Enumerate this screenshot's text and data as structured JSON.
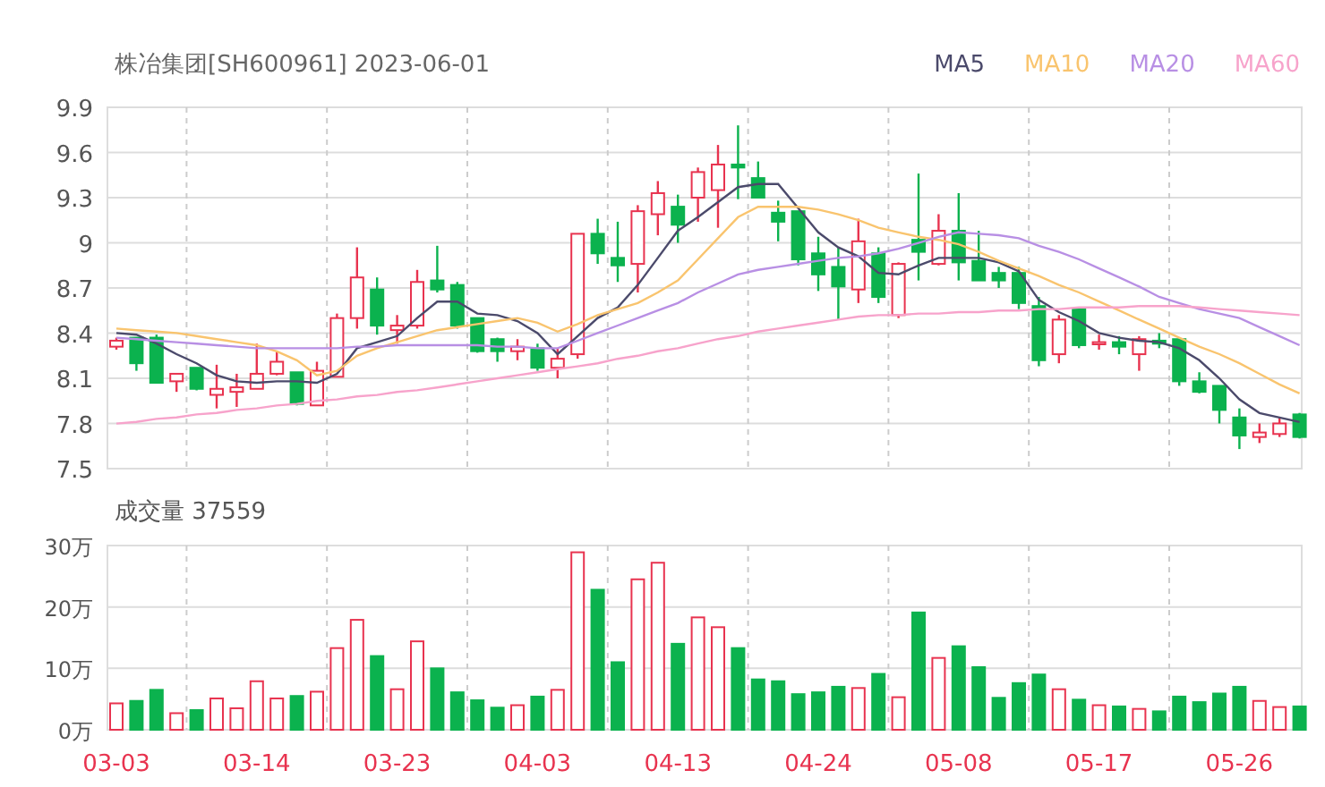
{
  "header": {
    "title": "株冶集团[SH600961] 2023-06-01"
  },
  "price_chart": {
    "chart_data": {
      "type": "candlestick",
      "grid": true,
      "ylim": [
        7.5,
        9.9
      ],
      "yticks": [
        {
          "value": 9.9,
          "label": "9.9"
        },
        {
          "value": 9.6,
          "label": "9.6"
        },
        {
          "value": 9.3,
          "label": "9.3"
        },
        {
          "value": 9.0,
          "label": "9"
        },
        {
          "value": 8.7,
          "label": "8.7"
        },
        {
          "value": 8.4,
          "label": "8.4"
        },
        {
          "value": 8.1,
          "label": "8.1"
        },
        {
          "value": 7.8,
          "label": "7.8"
        },
        {
          "value": 7.5,
          "label": "7.5"
        }
      ],
      "ohlc": [
        [
          8.31,
          8.37,
          8.29,
          8.35
        ],
        [
          8.37,
          8.37,
          8.15,
          8.2
        ],
        [
          8.37,
          8.39,
          8.07,
          8.07
        ],
        [
          8.08,
          8.13,
          8.01,
          8.13
        ],
        [
          8.17,
          8.17,
          8.02,
          8.03
        ],
        [
          7.99,
          8.19,
          7.9,
          8.03
        ],
        [
          8.01,
          8.13,
          7.91,
          8.04
        ],
        [
          8.03,
          8.33,
          8.03,
          8.13
        ],
        [
          8.13,
          8.28,
          8.12,
          8.21
        ],
        [
          8.14,
          8.14,
          7.92,
          7.93
        ],
        [
          7.92,
          8.21,
          7.92,
          8.15
        ],
        [
          8.11,
          8.53,
          8.11,
          8.5
        ],
        [
          8.5,
          8.97,
          8.43,
          8.77
        ],
        [
          8.69,
          8.77,
          8.39,
          8.45
        ],
        [
          8.42,
          8.52,
          8.33,
          8.45
        ],
        [
          8.45,
          8.82,
          8.43,
          8.74
        ],
        [
          8.75,
          8.98,
          8.67,
          8.69
        ],
        [
          8.72,
          8.74,
          8.43,
          8.45
        ],
        [
          8.5,
          8.5,
          8.27,
          8.28
        ],
        [
          8.36,
          8.37,
          8.21,
          8.28
        ],
        [
          8.28,
          8.36,
          8.22,
          8.31
        ],
        [
          8.3,
          8.33,
          8.15,
          8.17
        ],
        [
          8.17,
          8.3,
          8.1,
          8.23
        ],
        [
          8.26,
          9.06,
          8.23,
          9.06
        ],
        [
          9.06,
          9.16,
          8.86,
          8.93
        ],
        [
          8.9,
          9.14,
          8.74,
          8.85
        ],
        [
          8.86,
          9.25,
          8.67,
          9.21
        ],
        [
          9.19,
          9.41,
          9.05,
          9.33
        ],
        [
          9.24,
          9.32,
          9.0,
          9.12
        ],
        [
          9.3,
          9.5,
          9.14,
          9.47
        ],
        [
          9.35,
          9.65,
          9.1,
          9.52
        ],
        [
          9.52,
          9.78,
          9.29,
          9.5
        ],
        [
          9.43,
          9.54,
          9.3,
          9.3
        ],
        [
          9.2,
          9.28,
          9.01,
          9.14
        ],
        [
          9.21,
          9.21,
          8.85,
          8.89
        ],
        [
          8.93,
          9.04,
          8.68,
          8.79
        ],
        [
          8.84,
          8.97,
          8.49,
          8.71
        ],
        [
          8.69,
          9.16,
          8.6,
          9.01
        ],
        [
          8.93,
          8.97,
          8.6,
          8.64
        ],
        [
          8.52,
          8.87,
          8.5,
          8.86
        ],
        [
          9.02,
          9.46,
          8.75,
          8.94
        ],
        [
          8.86,
          9.19,
          8.85,
          9.08
        ],
        [
          9.08,
          9.33,
          8.75,
          8.87
        ],
        [
          8.88,
          9.08,
          8.75,
          8.75
        ],
        [
          8.8,
          8.84,
          8.7,
          8.75
        ],
        [
          8.8,
          8.84,
          8.56,
          8.6
        ],
        [
          8.58,
          8.64,
          8.18,
          8.22
        ],
        [
          8.26,
          8.52,
          8.2,
          8.49
        ],
        [
          8.56,
          8.56,
          8.3,
          8.32
        ],
        [
          8.33,
          8.39,
          8.29,
          8.34
        ],
        [
          8.34,
          8.38,
          8.26,
          8.31
        ],
        [
          8.26,
          8.38,
          8.15,
          8.36
        ],
        [
          8.35,
          8.4,
          8.3,
          8.33
        ],
        [
          8.36,
          8.36,
          8.05,
          8.08
        ],
        [
          8.08,
          8.14,
          8.0,
          8.01
        ],
        [
          8.05,
          8.05,
          7.8,
          7.89
        ],
        [
          7.84,
          7.9,
          7.63,
          7.72
        ],
        [
          7.71,
          7.8,
          7.67,
          7.74
        ],
        [
          7.73,
          7.84,
          7.71,
          7.8
        ],
        [
          7.86,
          7.87,
          7.7,
          7.71
        ]
      ]
    }
  },
  "moving_averages": {
    "chart_data": {
      "type": "line",
      "ylim": [
        7.5,
        9.9
      ],
      "series": [
        {
          "name": "MA5",
          "color": "#4b4a6b",
          "values": [
            8.4,
            8.39,
            8.33,
            8.26,
            8.2,
            8.12,
            8.08,
            8.07,
            8.08,
            8.08,
            8.07,
            8.13,
            8.3,
            8.34,
            8.38,
            8.5,
            8.61,
            8.61,
            8.53,
            8.52,
            8.48,
            8.4,
            8.26,
            8.38,
            8.5,
            8.57,
            8.72,
            8.9,
            9.08,
            9.17,
            9.27,
            9.37,
            9.39,
            9.39,
            9.23,
            9.07,
            8.97,
            8.91,
            8.8,
            8.79,
            8.85,
            8.9,
            8.9,
            8.9,
            8.87,
            8.81,
            8.62,
            8.54,
            8.48,
            8.4,
            8.37,
            8.35,
            8.34,
            8.3,
            8.22,
            8.1,
            7.96,
            7.87,
            7.84,
            7.81
          ]
        },
        {
          "name": "MA10",
          "color": "#f9c46e",
          "values": [
            8.43,
            8.42,
            8.41,
            8.4,
            8.38,
            8.36,
            8.34,
            8.32,
            8.28,
            8.22,
            8.12,
            8.15,
            8.25,
            8.3,
            8.34,
            8.38,
            8.42,
            8.44,
            8.46,
            8.48,
            8.5,
            8.47,
            8.41,
            8.46,
            8.52,
            8.56,
            8.6,
            8.67,
            8.75,
            8.89,
            9.03,
            9.17,
            9.24,
            9.24,
            9.24,
            9.22,
            9.19,
            9.15,
            9.1,
            9.07,
            9.04,
            9.02,
            8.99,
            8.94,
            8.88,
            8.83,
            8.78,
            8.72,
            8.67,
            8.61,
            8.55,
            8.49,
            8.43,
            8.37,
            8.31,
            8.26,
            8.2,
            8.13,
            8.06,
            8.0
          ]
        },
        {
          "name": "MA20",
          "color": "#b88fe4",
          "values": [
            8.37,
            8.36,
            8.35,
            8.34,
            8.33,
            8.32,
            8.31,
            8.3,
            8.3,
            8.3,
            8.3,
            8.3,
            8.31,
            8.31,
            8.32,
            8.32,
            8.32,
            8.32,
            8.32,
            8.31,
            8.31,
            8.3,
            8.3,
            8.35,
            8.4,
            8.45,
            8.5,
            8.55,
            8.6,
            8.67,
            8.73,
            8.79,
            8.82,
            8.84,
            8.86,
            8.88,
            8.9,
            8.91,
            8.93,
            8.96,
            9.0,
            9.04,
            9.07,
            9.06,
            9.05,
            9.03,
            8.98,
            8.94,
            8.89,
            8.83,
            8.77,
            8.71,
            8.64,
            8.6,
            8.56,
            8.53,
            8.5,
            8.44,
            8.38,
            8.32
          ]
        },
        {
          "name": "MA60",
          "color": "#f7a3cb",
          "values": [
            7.8,
            7.81,
            7.83,
            7.84,
            7.86,
            7.87,
            7.89,
            7.9,
            7.92,
            7.93,
            7.95,
            7.96,
            7.98,
            7.99,
            8.01,
            8.02,
            8.04,
            8.06,
            8.08,
            8.1,
            8.12,
            8.14,
            8.16,
            8.18,
            8.2,
            8.23,
            8.25,
            8.28,
            8.3,
            8.33,
            8.36,
            8.38,
            8.41,
            8.43,
            8.45,
            8.47,
            8.49,
            8.51,
            8.52,
            8.52,
            8.53,
            8.53,
            8.54,
            8.54,
            8.55,
            8.55,
            8.56,
            8.56,
            8.57,
            8.57,
            8.57,
            8.58,
            8.58,
            8.58,
            8.57,
            8.56,
            8.55,
            8.54,
            8.53,
            8.52
          ]
        }
      ]
    }
  },
  "volume_chart": {
    "label": "成交量",
    "value": "37559",
    "chart_data": {
      "type": "bar",
      "grid": true,
      "ylim": [
        0,
        30
      ],
      "categories": [
        "03-03",
        null,
        null,
        null,
        null,
        null,
        null,
        "03-14",
        null,
        null,
        null,
        null,
        null,
        null,
        "03-23",
        null,
        null,
        null,
        null,
        null,
        null,
        "04-03",
        null,
        null,
        null,
        null,
        null,
        null,
        "04-13",
        null,
        null,
        null,
        null,
        null,
        null,
        "04-24",
        null,
        null,
        null,
        null,
        null,
        null,
        "05-08",
        null,
        null,
        null,
        null,
        null,
        null,
        "05-17",
        null,
        null,
        null,
        null,
        null,
        null,
        "05-26",
        null,
        null,
        null
      ],
      "yticks": [
        {
          "value": 30,
          "label": "30万"
        },
        {
          "value": 20,
          "label": "20万"
        },
        {
          "value": 10,
          "label": "10万"
        },
        {
          "value": 0,
          "label": "0万"
        }
      ],
      "values": [
        4.3,
        4.7,
        6.5,
        2.7,
        3.2,
        5.1,
        3.5,
        7.9,
        5.1,
        5.5,
        6.2,
        13.3,
        17.9,
        12.0,
        6.6,
        14.4,
        10.0,
        6.1,
        4.8,
        3.6,
        4.0,
        5.4,
        6.5,
        28.9,
        22.8,
        11.0,
        24.5,
        27.2,
        14.0,
        18.3,
        16.7,
        13.3,
        8.2,
        7.9,
        5.8,
        6.1,
        7.0,
        6.8,
        9.1,
        5.3,
        19.1,
        11.7,
        13.6,
        10.2,
        5.2,
        7.6,
        9.0,
        6.6,
        4.9,
        4.0,
        3.8,
        3.4,
        3.0,
        5.4,
        4.5,
        5.9,
        7.0,
        4.7,
        3.7,
        3.8
      ]
    }
  }
}
